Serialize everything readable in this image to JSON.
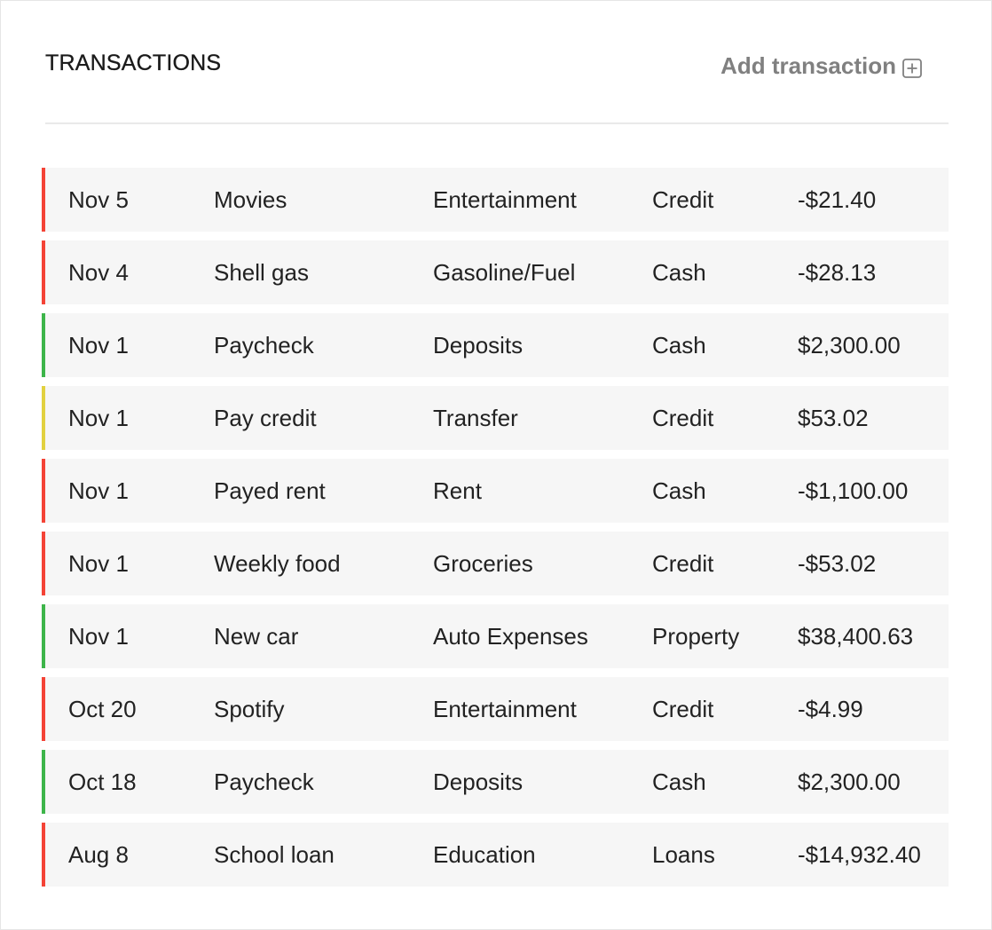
{
  "header": {
    "title": "TRANSACTIONS",
    "add_label": "Add transaction"
  },
  "colors": {
    "expense": "#f44336",
    "income": "#3db54a",
    "transfer": "#e2d13f"
  },
  "transactions": [
    {
      "date": "Nov 5",
      "description": "Movies",
      "category": "Entertainment",
      "account": "Credit",
      "amount": "-$21.40",
      "type": "expense"
    },
    {
      "date": "Nov 4",
      "description": "Shell gas",
      "category": "Gasoline/Fuel",
      "account": "Cash",
      "amount": "-$28.13",
      "type": "expense"
    },
    {
      "date": "Nov 1",
      "description": "Paycheck",
      "category": "Deposits",
      "account": "Cash",
      "amount": "$2,300.00",
      "type": "income"
    },
    {
      "date": "Nov 1",
      "description": "Pay credit",
      "category": "Transfer",
      "account": "Credit",
      "amount": "$53.02",
      "type": "transfer"
    },
    {
      "date": "Nov 1",
      "description": "Payed rent",
      "category": "Rent",
      "account": "Cash",
      "amount": "-$1,100.00",
      "type": "expense"
    },
    {
      "date": "Nov 1",
      "description": "Weekly food",
      "category": "Groceries",
      "account": "Credit",
      "amount": "-$53.02",
      "type": "expense"
    },
    {
      "date": "Nov 1",
      "description": "New car",
      "category": "Auto Expenses",
      "account": "Property",
      "amount": "$38,400.63",
      "type": "income"
    },
    {
      "date": "Oct 20",
      "description": "Spotify",
      "category": "Entertainment",
      "account": "Credit",
      "amount": "-$4.99",
      "type": "expense"
    },
    {
      "date": "Oct 18",
      "description": "Paycheck",
      "category": "Deposits",
      "account": "Cash",
      "amount": "$2,300.00",
      "type": "income"
    },
    {
      "date": "Aug 8",
      "description": "School loan",
      "category": "Education",
      "account": "Loans",
      "amount": "-$14,932.40",
      "type": "expense"
    }
  ]
}
